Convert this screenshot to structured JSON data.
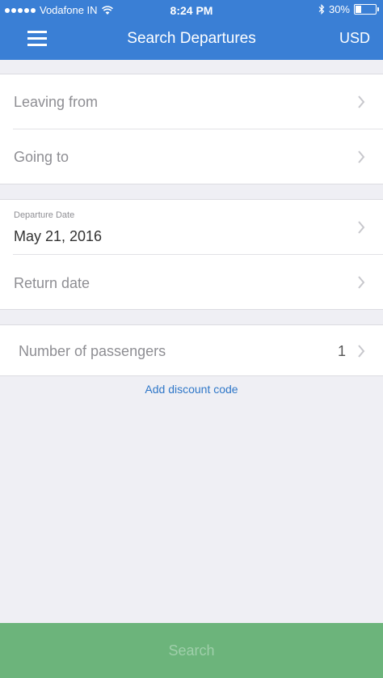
{
  "status_bar": {
    "carrier": "Vodafone IN",
    "time": "8:24 PM",
    "battery": "30%",
    "battery_level": 0.3
  },
  "nav": {
    "title": "Search Departures",
    "currency": "USD"
  },
  "route": {
    "leaving_from": "Leaving from",
    "going_to": "Going to"
  },
  "dates": {
    "departure_label": "Departure Date",
    "departure_value": "May 21, 2016",
    "return_placeholder": "Return date"
  },
  "passengers": {
    "label": "Number of passengers",
    "count": "1"
  },
  "discount_link": "Add discount code",
  "search_button": "Search",
  "colors": {
    "header_blue": "#3a7fd5",
    "search_green": "#6cb47b",
    "link_blue": "#2f77c8",
    "background": "#efeff4"
  }
}
